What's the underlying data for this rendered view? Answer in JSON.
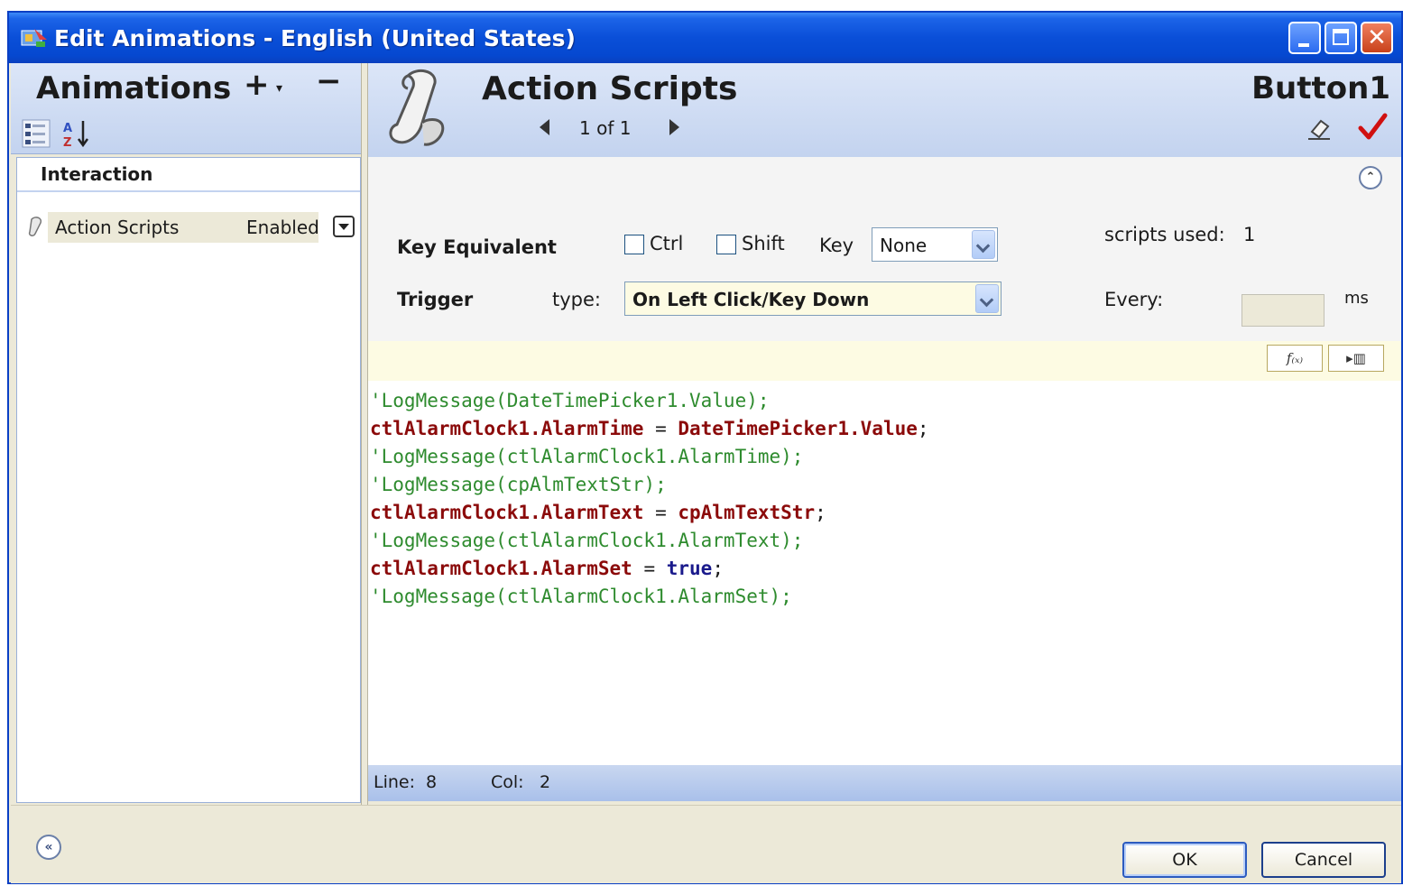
{
  "window": {
    "title": "Edit Animations - English (United States)",
    "close_glyph": "✕"
  },
  "left": {
    "title": "Animations",
    "add_label": "+",
    "add_dropdown": "▾",
    "remove_label": "−",
    "group_label": "Interaction",
    "items": [
      {
        "name": "Action Scripts",
        "state": "Enabled"
      }
    ]
  },
  "header": {
    "title": "Action Scripts",
    "pager": "1 of 1",
    "object_name": "Button1"
  },
  "config": {
    "collapse_glyph": "⌃",
    "key_equivalent_label": "Key Equivalent",
    "ctrl_label": "Ctrl",
    "shift_label": "Shift",
    "key_label": "Key",
    "key_value": "None",
    "scripts_used_label": "scripts used:",
    "scripts_used_value": "1",
    "trigger_label": "Trigger",
    "type_label": "type:",
    "type_value": "On Left Click/Key Down",
    "every_label": "Every:",
    "every_value": "",
    "ms_label": "ms"
  },
  "toolbar": {
    "func_label": "f₍ₓ₎",
    "insert_label": "▸▥"
  },
  "code": {
    "lines": [
      {
        "kind": "comment",
        "text": "'LogMessage(DateTimePicker1.Value);"
      },
      {
        "kind": "code",
        "left": "ctlAlarmClock1.AlarmTime",
        "op": " = ",
        "right": "DateTimePicker1.Value",
        "end": ";"
      },
      {
        "kind": "comment",
        "text": "'LogMessage(ctlAlarmClock1.AlarmTime);"
      },
      {
        "kind": "comment",
        "text": "'LogMessage(cpAlmTextStr);"
      },
      {
        "kind": "code",
        "left": "ctlAlarmClock1.AlarmText",
        "op": " = ",
        "right": "cpAlmTextStr",
        "end": ";"
      },
      {
        "kind": "comment",
        "text": "'LogMessage(ctlAlarmClock1.AlarmText);"
      },
      {
        "kind": "code-kw",
        "left": "ctlAlarmClock1.AlarmSet",
        "op": " = ",
        "right": "true",
        "end": ";"
      },
      {
        "kind": "comment",
        "text": "'LogMessage(ctlAlarmClock1.AlarmSet);"
      }
    ]
  },
  "status": {
    "line_label": "Line:",
    "line_value": "8",
    "col_label": "Col:",
    "col_value": "2"
  },
  "buttons": {
    "expand_glyph": "«",
    "ok": "OK",
    "cancel": "Cancel"
  },
  "colors": {
    "titlebar": "#0a4fd8",
    "comment": "#2e8b2e",
    "code": "#8b0a0a",
    "keyword": "#1a1a8c",
    "check": "#d01010"
  },
  "icons": [
    "app-icon",
    "categorize-icon",
    "sort-alpha-icon",
    "action-script-icon",
    "scroll-icon",
    "eraser-icon",
    "checkmark-icon"
  ]
}
